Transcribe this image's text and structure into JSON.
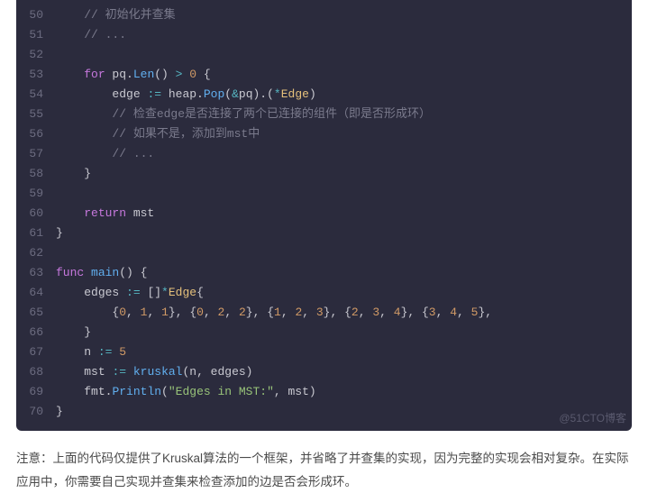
{
  "watermark": "@51CTO博客",
  "note": "注意：上面的代码仅提供了Kruskal算法的一个框架，并省略了并查集的实现，因为完整的实现会相对复杂。在实际应用中，你需要自己实现并查集来检查添加的边是否会形成环。",
  "lines": [
    {
      "n": 50,
      "segs": [
        {
          "t": "    ",
          "c": ""
        },
        {
          "t": "// 初始化并查集",
          "c": "tok-comment"
        }
      ]
    },
    {
      "n": 51,
      "segs": [
        {
          "t": "    ",
          "c": ""
        },
        {
          "t": "// ...",
          "c": "tok-comment"
        }
      ]
    },
    {
      "n": 52,
      "segs": []
    },
    {
      "n": 53,
      "segs": [
        {
          "t": "    ",
          "c": ""
        },
        {
          "t": "for",
          "c": "tok-for"
        },
        {
          "t": " pq.",
          "c": "tok-ident"
        },
        {
          "t": "Len",
          "c": "tok-call"
        },
        {
          "t": "() ",
          "c": "tok-punc"
        },
        {
          "t": ">",
          "c": "tok-op"
        },
        {
          "t": " ",
          "c": ""
        },
        {
          "t": "0",
          "c": "tok-num"
        },
        {
          "t": " {",
          "c": "tok-brace"
        }
      ]
    },
    {
      "n": 54,
      "segs": [
        {
          "t": "        ",
          "c": ""
        },
        {
          "t": "edge ",
          "c": "tok-ident"
        },
        {
          "t": ":=",
          "c": "tok-op"
        },
        {
          "t": " heap.",
          "c": "tok-ident"
        },
        {
          "t": "Pop",
          "c": "tok-call"
        },
        {
          "t": "(",
          "c": "tok-punc"
        },
        {
          "t": "&",
          "c": "tok-op"
        },
        {
          "t": "pq).(",
          "c": "tok-punc"
        },
        {
          "t": "*",
          "c": "tok-op"
        },
        {
          "t": "Edge",
          "c": "tok-type"
        },
        {
          "t": ")",
          "c": "tok-punc"
        }
      ]
    },
    {
      "n": 55,
      "segs": [
        {
          "t": "        ",
          "c": ""
        },
        {
          "t": "// 检查edge是否连接了两个已连接的组件（即是否形成环）",
          "c": "tok-comment"
        }
      ]
    },
    {
      "n": 56,
      "segs": [
        {
          "t": "        ",
          "c": ""
        },
        {
          "t": "// 如果不是，添加到mst中",
          "c": "tok-comment"
        }
      ]
    },
    {
      "n": 57,
      "segs": [
        {
          "t": "        ",
          "c": ""
        },
        {
          "t": "// ...",
          "c": "tok-comment"
        }
      ]
    },
    {
      "n": 58,
      "segs": [
        {
          "t": "    ",
          "c": ""
        },
        {
          "t": "}",
          "c": "tok-brace"
        }
      ]
    },
    {
      "n": 59,
      "segs": []
    },
    {
      "n": 60,
      "segs": [
        {
          "t": "    ",
          "c": ""
        },
        {
          "t": "return",
          "c": "tok-return"
        },
        {
          "t": " mst",
          "c": "tok-ident"
        }
      ]
    },
    {
      "n": 61,
      "segs": [
        {
          "t": "}",
          "c": "tok-brace"
        }
      ]
    },
    {
      "n": 62,
      "segs": []
    },
    {
      "n": 63,
      "segs": [
        {
          "t": "func",
          "c": "tok-func"
        },
        {
          "t": " ",
          "c": ""
        },
        {
          "t": "main",
          "c": "tok-call"
        },
        {
          "t": "()",
          "c": "tok-punc"
        },
        {
          "t": " {",
          "c": "tok-brace"
        }
      ]
    },
    {
      "n": 64,
      "segs": [
        {
          "t": "    ",
          "c": ""
        },
        {
          "t": "edges ",
          "c": "tok-ident"
        },
        {
          "t": ":=",
          "c": "tok-op"
        },
        {
          "t": " []",
          "c": "tok-punc"
        },
        {
          "t": "*",
          "c": "tok-op"
        },
        {
          "t": "Edge",
          "c": "tok-type"
        },
        {
          "t": "{",
          "c": "tok-brace"
        }
      ]
    },
    {
      "n": 65,
      "segs": [
        {
          "t": "        ",
          "c": ""
        },
        {
          "t": "{",
          "c": "tok-brace"
        },
        {
          "t": "0",
          "c": "tok-num"
        },
        {
          "t": ", ",
          "c": "tok-punc"
        },
        {
          "t": "1",
          "c": "tok-num"
        },
        {
          "t": ", ",
          "c": "tok-punc"
        },
        {
          "t": "1",
          "c": "tok-num"
        },
        {
          "t": "}",
          "c": "tok-brace"
        },
        {
          "t": ", ",
          "c": "tok-punc"
        },
        {
          "t": "{",
          "c": "tok-brace"
        },
        {
          "t": "0",
          "c": "tok-num"
        },
        {
          "t": ", ",
          "c": "tok-punc"
        },
        {
          "t": "2",
          "c": "tok-num"
        },
        {
          "t": ", ",
          "c": "tok-punc"
        },
        {
          "t": "2",
          "c": "tok-num"
        },
        {
          "t": "}",
          "c": "tok-brace"
        },
        {
          "t": ", ",
          "c": "tok-punc"
        },
        {
          "t": "{",
          "c": "tok-brace"
        },
        {
          "t": "1",
          "c": "tok-num"
        },
        {
          "t": ", ",
          "c": "tok-punc"
        },
        {
          "t": "2",
          "c": "tok-num"
        },
        {
          "t": ", ",
          "c": "tok-punc"
        },
        {
          "t": "3",
          "c": "tok-num"
        },
        {
          "t": "}",
          "c": "tok-brace"
        },
        {
          "t": ", ",
          "c": "tok-punc"
        },
        {
          "t": "{",
          "c": "tok-brace"
        },
        {
          "t": "2",
          "c": "tok-num"
        },
        {
          "t": ", ",
          "c": "tok-punc"
        },
        {
          "t": "3",
          "c": "tok-num"
        },
        {
          "t": ", ",
          "c": "tok-punc"
        },
        {
          "t": "4",
          "c": "tok-num"
        },
        {
          "t": "}",
          "c": "tok-brace"
        },
        {
          "t": ", ",
          "c": "tok-punc"
        },
        {
          "t": "{",
          "c": "tok-brace"
        },
        {
          "t": "3",
          "c": "tok-num"
        },
        {
          "t": ", ",
          "c": "tok-punc"
        },
        {
          "t": "4",
          "c": "tok-num"
        },
        {
          "t": ", ",
          "c": "tok-punc"
        },
        {
          "t": "5",
          "c": "tok-num"
        },
        {
          "t": "}",
          "c": "tok-brace"
        },
        {
          "t": ",",
          "c": "tok-punc"
        }
      ]
    },
    {
      "n": 66,
      "segs": [
        {
          "t": "    ",
          "c": ""
        },
        {
          "t": "}",
          "c": "tok-brace"
        }
      ]
    },
    {
      "n": 67,
      "segs": [
        {
          "t": "    ",
          "c": ""
        },
        {
          "t": "n ",
          "c": "tok-ident"
        },
        {
          "t": ":=",
          "c": "tok-op"
        },
        {
          "t": " ",
          "c": ""
        },
        {
          "t": "5",
          "c": "tok-num"
        }
      ]
    },
    {
      "n": 68,
      "segs": [
        {
          "t": "    ",
          "c": ""
        },
        {
          "t": "mst ",
          "c": "tok-ident"
        },
        {
          "t": ":=",
          "c": "tok-op"
        },
        {
          "t": " ",
          "c": ""
        },
        {
          "t": "kruskal",
          "c": "tok-call"
        },
        {
          "t": "(n, edges)",
          "c": "tok-punc"
        }
      ]
    },
    {
      "n": 69,
      "segs": [
        {
          "t": "    ",
          "c": ""
        },
        {
          "t": "fmt.",
          "c": "tok-ident"
        },
        {
          "t": "Println",
          "c": "tok-call"
        },
        {
          "t": "(",
          "c": "tok-punc"
        },
        {
          "t": "\"Edges in MST:\"",
          "c": "tok-string"
        },
        {
          "t": ", mst)",
          "c": "tok-punc"
        }
      ]
    },
    {
      "n": 70,
      "segs": [
        {
          "t": "}",
          "c": "tok-brace"
        }
      ]
    }
  ]
}
